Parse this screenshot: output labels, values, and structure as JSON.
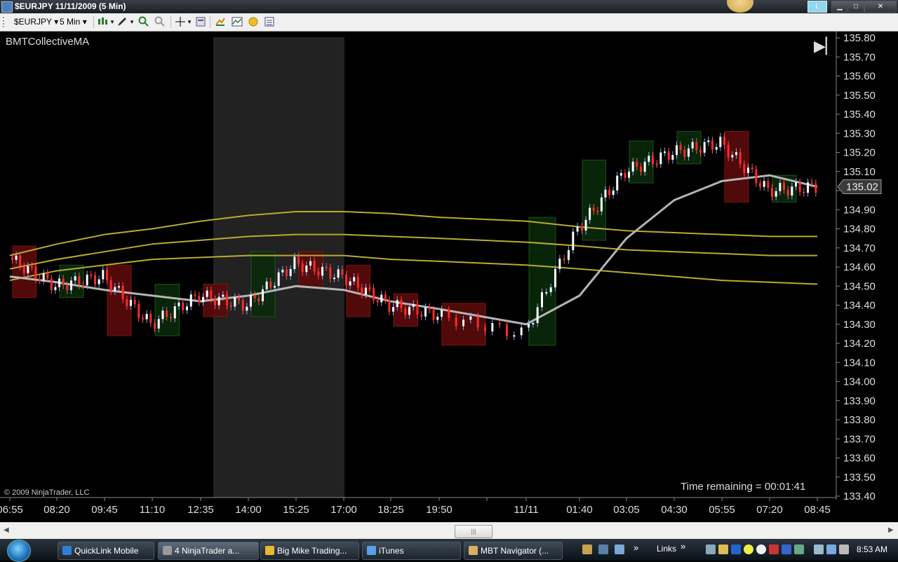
{
  "window": {
    "title": "$EURJPY  11/11/2009 (5 Min)",
    "l_button": "L",
    "minimize_glyph": "▁",
    "maximize_glyph": "□",
    "close_glyph": "✕"
  },
  "toolbar": {
    "instrument": "$EURJPY",
    "interval": "5 Min",
    "dropdown_glyph": "▾",
    "icons": [
      "candlestick-icon",
      "pencil-draw-icon",
      "zoom-in-icon",
      "zoom-out-icon",
      "crosshair-icon",
      "properties-icon",
      "strategy-icon",
      "indicators-icon",
      "coin-icon",
      "data-box-icon"
    ]
  },
  "chart": {
    "indicator_label": "BMTCollectiveMA",
    "copyright": "© 2009 NinjaTrader, LLC",
    "time_remaining": "Time remaining = 00:01:41",
    "scroll_to_end_glyph": "▶▏",
    "last_price": "135.02",
    "price_ticks": [
      "135.80",
      "135.70",
      "135.60",
      "135.50",
      "135.40",
      "135.30",
      "135.20",
      "135.10",
      "135.00",
      "134.90",
      "134.80",
      "134.70",
      "134.60",
      "134.50",
      "134.40",
      "134.30",
      "134.20",
      "134.10",
      "134.00",
      "133.90",
      "133.80",
      "133.70",
      "133.60",
      "133.50",
      "133.40"
    ],
    "time_ticks": [
      "06:55",
      "08:20",
      "09:45",
      "11:10",
      "12:35",
      "14:00",
      "15:25",
      "17:00",
      "18:25",
      "19:50",
      "",
      "11/11",
      "01:40",
      "03:05",
      "04:30",
      "05:55",
      "07:20",
      "08:45"
    ]
  },
  "chart_data": {
    "type": "line",
    "title": "BMTCollectiveMA",
    "ylim": [
      133.4,
      135.8
    ],
    "x": [
      "06:55",
      "08:20",
      "09:45",
      "11:10",
      "12:35",
      "14:00",
      "15:25",
      "17:00",
      "18:25",
      "19:50",
      "11/11",
      "01:40",
      "03:05",
      "04:30",
      "05:55",
      "07:20",
      "08:45"
    ],
    "series": [
      {
        "values": [
          134.65,
          134.5,
          134.55,
          134.3,
          134.45,
          134.4,
          134.62,
          134.55,
          134.4,
          134.35,
          134.25,
          134.8,
          135.1,
          135.2,
          135.25,
          135.0,
          135.02
        ]
      },
      {
        "values": [
          134.55,
          134.52,
          134.48,
          134.45,
          134.42,
          134.45,
          134.5,
          134.48,
          134.42,
          134.38,
          134.3,
          134.45,
          134.75,
          134.95,
          135.05,
          135.08,
          135.02
        ]
      },
      {
        "values": [
          134.66,
          134.72,
          134.77,
          134.8,
          134.84,
          134.87,
          134.89,
          134.89,
          134.88,
          134.86,
          134.84,
          134.81,
          134.79,
          134.78,
          134.77,
          134.76,
          134.76
        ]
      },
      {
        "values": [
          134.59,
          134.64,
          134.68,
          134.72,
          134.74,
          134.76,
          134.77,
          134.77,
          134.76,
          134.75,
          134.73,
          134.71,
          134.69,
          134.68,
          134.67,
          134.66,
          134.66
        ]
      },
      {
        "values": [
          134.53,
          134.58,
          134.61,
          134.64,
          134.65,
          134.66,
          134.66,
          134.66,
          134.64,
          134.63,
          134.61,
          134.59,
          134.57,
          134.55,
          134.53,
          134.52,
          134.51
        ]
      }
    ],
    "last_price": 135.02,
    "session_shading": {
      "start": "12:35",
      "end": "17:00"
    }
  },
  "scrollbar": {
    "left_arrow": "◀",
    "right_arrow": "▶",
    "thumb_glyph": "|||"
  },
  "taskbar": {
    "tasks": [
      {
        "label": "QuickLink Mobile",
        "color": "#2f7fd6"
      },
      {
        "label": "4 NinjaTrader a...",
        "color": "#999999"
      },
      {
        "label": "Big Mike Trading...",
        "color": "#e8b830"
      },
      {
        "label": "iTunes",
        "color": "#5aa0e8"
      },
      {
        "label": "MBT Navigator (...",
        "color": "#d8b060"
      }
    ],
    "overflow_glyph": "»",
    "links_label": "Links",
    "clock": "8:53 AM"
  },
  "colors": {
    "up_candle": "#ffffff",
    "down_candle": "#ff2a2a",
    "ma_gray": "#b5b5b5",
    "ma_yellow": "#b8ad2e",
    "session_box_down": "#5a0a0a",
    "session_box_up": "#0b2a0b"
  }
}
